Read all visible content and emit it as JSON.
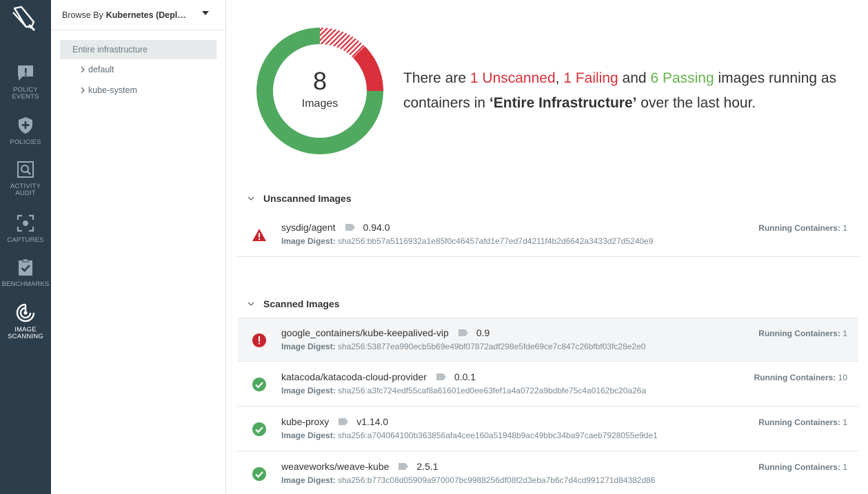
{
  "nav": {
    "items": [
      {
        "label_line1": "POLICY",
        "label_line2": "EVENTS",
        "icon": "chat-alert-icon"
      },
      {
        "label_line1": "POLICIES",
        "label_line2": "",
        "icon": "shield-plus-icon"
      },
      {
        "label_line1": "ACTIVITY",
        "label_line2": "AUDIT",
        "icon": "search-window-icon"
      },
      {
        "label_line1": "CAPTURES",
        "label_line2": "",
        "icon": "capture-frame-icon"
      },
      {
        "label_line1": "BENCHMARKS",
        "label_line2": "",
        "icon": "clipboard-check-icon"
      },
      {
        "label_line1": "IMAGE",
        "label_line2": "SCANNING",
        "icon": "scan-target-icon"
      }
    ],
    "active_index": 5
  },
  "browse": {
    "prefix": "Browse By",
    "value": "Kubernetes (Deployments)"
  },
  "tree": {
    "root": "Entire infrastructure",
    "items": [
      "default",
      "kube-system"
    ]
  },
  "summary": {
    "total": "8",
    "total_label": "Images",
    "text_1": "There are ",
    "unscanned": "1 Unscanned",
    "sep_1": ", ",
    "failing": "1 Failing",
    "sep_2": " and ",
    "passing": "6 Passing",
    "text_2": " images running as containers in ",
    "scope": "‘Entire Infrastructure’",
    "text_3": " over the last hour.",
    "counts": {
      "unscanned": 1,
      "failing": 1,
      "passing": 6
    },
    "colors": {
      "unscanned": "#d9303b",
      "failing": "#d9303b",
      "passing": "#4fa95f"
    }
  },
  "sections": {
    "unscanned_title": "Unscanned Images",
    "scanned_title": "Scanned Images"
  },
  "labels": {
    "digest": "Image Digest:",
    "containers": "Running Containers:"
  },
  "unscanned_images": [
    {
      "name": "sysdig/agent",
      "tag": "0.94.0",
      "digest": "sha256:bb57a5116932a1e85f0c46457afd1e77ed7d4211f4b2d6642a3433d27d5240e9",
      "containers": "1",
      "status": "warning"
    }
  ],
  "scanned_images": [
    {
      "name": "google_containers/kube-keepalived-vip",
      "tag": "0.9",
      "digest": "sha256:53877ea990ecb5b69e49bf07872adf298e5fde69ce7c847c26bfbf03fc28e2e0",
      "containers": "1",
      "status": "failing"
    },
    {
      "name": "katacoda/katacoda-cloud-provider",
      "tag": "0.0.1",
      "digest": "sha256:a3fc724edf55caf8a61601ed0ee63fef1a4a0722a9bdbfe75c4a0162bc20a26a",
      "containers": "10",
      "status": "passing"
    },
    {
      "name": "kube-proxy",
      "tag": "v1.14.0",
      "digest": "sha256:a704064100b363856afa4cee160a51948b9ac49bbc34ba97caeb7928055e9de1",
      "containers": "1",
      "status": "passing"
    },
    {
      "name": "weaveworks/weave-kube",
      "tag": "2.5.1",
      "digest": "sha256:b773c08d05909a970007bc9988256df08f2d3eba7b6c7d4cd991271d84382d86",
      "containers": "1",
      "status": "passing"
    }
  ]
}
